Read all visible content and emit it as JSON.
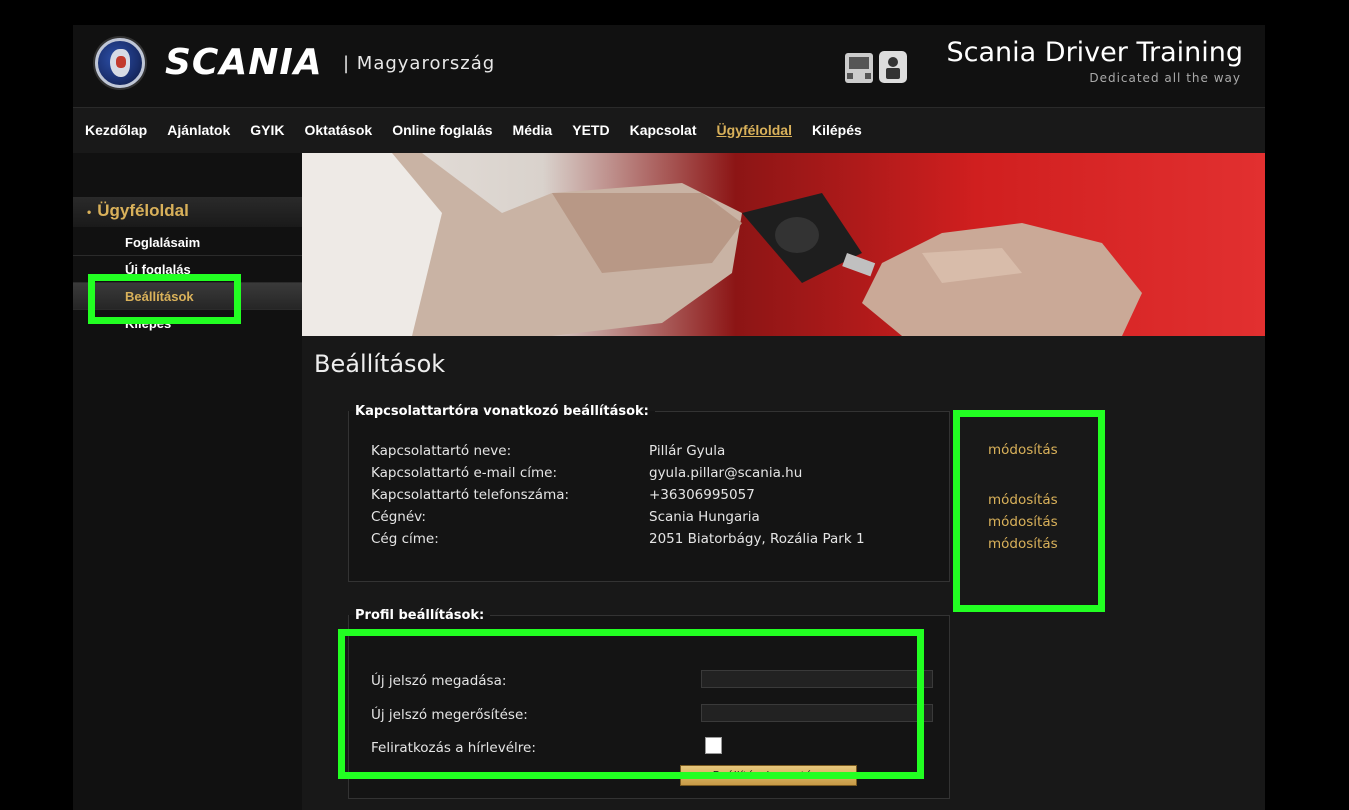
{
  "header": {
    "brand": "SCANIA",
    "region": "| Magyarország",
    "title": "Scania Driver Training",
    "tagline": "Dedicated all the way"
  },
  "nav": [
    {
      "label": "Kezdőlap"
    },
    {
      "label": "Ajánlatok"
    },
    {
      "label": "GYIK"
    },
    {
      "label": "Oktatások"
    },
    {
      "label": "Online foglalás"
    },
    {
      "label": "Média"
    },
    {
      "label": "YETD"
    },
    {
      "label": "Kapcsolat"
    },
    {
      "label": "Ügyféloldal",
      "active": true
    },
    {
      "label": "Kilépés"
    }
  ],
  "sidebar": {
    "heading": "Ügyféloldal",
    "items": [
      {
        "label": "Foglalásaim"
      },
      {
        "label": "Új foglalás"
      },
      {
        "label": "Beállítások",
        "active": true
      },
      {
        "label": "Kilépés"
      }
    ]
  },
  "page": {
    "title": "Beállítások"
  },
  "contact": {
    "legend": "Kapcsolattartóra vonatkozó beállítások:",
    "rows": [
      {
        "label": "Kapcsolattartó neve:",
        "value": "Pillár Gyula",
        "action": "módosítás"
      },
      {
        "label": "Kapcsolattartó e-mail címe:",
        "value": "gyula.pillar@scania.hu",
        "action": ""
      },
      {
        "label": "Kapcsolattartó telefonszáma:",
        "value": "+36306995057",
        "action": "módosítás"
      },
      {
        "label": "Cégnév:",
        "value": "Scania Hungaria",
        "action": "módosítás"
      },
      {
        "label": "Cég címe:",
        "value": "2051 Biatorbágy, Rozália Park 1",
        "action": "módosítás"
      }
    ]
  },
  "profile": {
    "legend": "Profil beállítások:",
    "new_password_label": "Új jelszó megadása:",
    "confirm_password_label": "Új jelszó megerősítése:",
    "newsletter_label": "Feliratkozás a hírlevélre:",
    "newsletter_checked": false,
    "save_label": "Beállítások mentése"
  },
  "colors": {
    "accent": "#d9b15a",
    "highlight": "#22ff22",
    "background": "#161616"
  }
}
